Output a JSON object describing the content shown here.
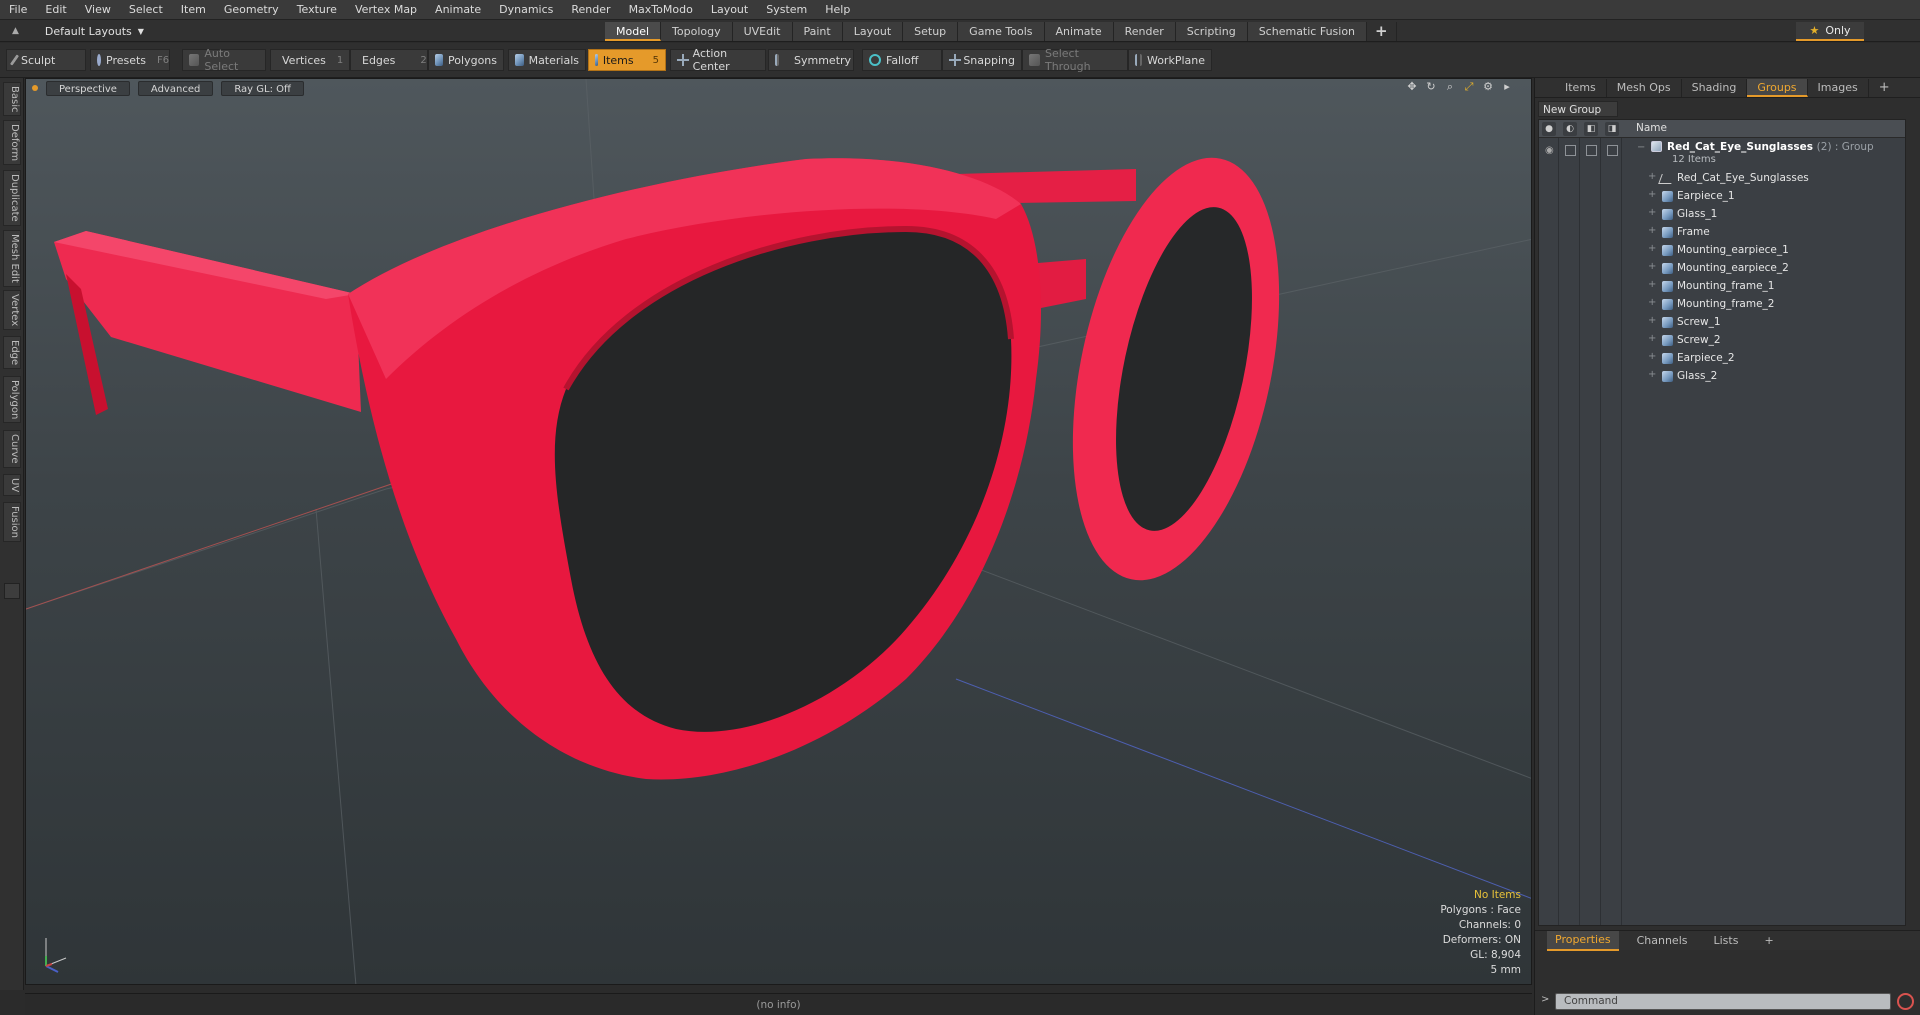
{
  "menu": [
    "File",
    "Edit",
    "View",
    "Select",
    "Item",
    "Geometry",
    "Texture",
    "Vertex Map",
    "Animate",
    "Dynamics",
    "Render",
    "MaxToModo",
    "Layout",
    "System",
    "Help"
  ],
  "layout_selector": "Default Layouts",
  "layout_tabs": [
    {
      "label": "Model",
      "active": true
    },
    {
      "label": "Topology"
    },
    {
      "label": "UVEdit"
    },
    {
      "label": "Paint"
    },
    {
      "label": "Layout"
    },
    {
      "label": "Setup"
    },
    {
      "label": "Game Tools"
    },
    {
      "label": "Animate"
    },
    {
      "label": "Render"
    },
    {
      "label": "Scripting"
    },
    {
      "label": "Schematic Fusion"
    },
    {
      "label": "+"
    }
  ],
  "only_label": "Only",
  "toolbar": {
    "sculpt": "Sculpt",
    "presets": "Presets",
    "presets_key": "F6",
    "auto_select": "Auto Select",
    "vertices": "Vertices",
    "vertices_key": "1",
    "edges": "Edges",
    "edges_key": "2",
    "polygons": "Polygons",
    "materials": "Materials",
    "items": "Items",
    "items_key": "5",
    "action_center": "Action Center",
    "symmetry": "Symmetry",
    "falloff": "Falloff",
    "snapping": "Snapping",
    "select_through": "Select Through",
    "workplane": "WorkPlane"
  },
  "left_tabs": [
    "Basic",
    "Deform",
    "Duplicate",
    "Mesh Edit",
    "Vertex",
    "Edge",
    "Polygon",
    "Curve",
    "UV",
    "Fusion"
  ],
  "viewport": {
    "view": "Perspective",
    "shading": "Advanced",
    "raygl": "Ray GL: Off",
    "info": {
      "no_items": "No Items",
      "polygons": "Polygons : Face",
      "channels": "Channels: 0",
      "deformers": "Deformers: ON",
      "gl": "GL: 8,904",
      "scale": "5 mm"
    }
  },
  "right_tabs": [
    {
      "label": "Items"
    },
    {
      "label": "Mesh Ops"
    },
    {
      "label": "Shading"
    },
    {
      "label": "Groups",
      "active": true
    },
    {
      "label": "Images"
    },
    {
      "label": "+"
    }
  ],
  "groups": {
    "new_group": "New Group",
    "column_name": "Name",
    "group_name": "Red_Cat_Eye_Sunglasses",
    "group_suffix": "(2) : Group",
    "group_count": "12 Items",
    "items": [
      "Red_Cat_Eye_Sunglasses",
      "Earpiece_1",
      "Glass_1",
      "Frame",
      "Mounting_earpiece_1",
      "Mounting_earpiece_2",
      "Mounting_frame_1",
      "Mounting_frame_2",
      "Screw_1",
      "Screw_2",
      "Earpiece_2",
      "Glass_2"
    ]
  },
  "bottom_tabs": [
    {
      "label": "Properties",
      "active": true
    },
    {
      "label": "Channels"
    },
    {
      "label": "Lists"
    },
    {
      "label": "+"
    }
  ],
  "command_placeholder": "Command",
  "status": "(no info)",
  "colors": {
    "accent": "#e59a2a",
    "frame_red": "#e8183f",
    "lens": "#252627"
  }
}
